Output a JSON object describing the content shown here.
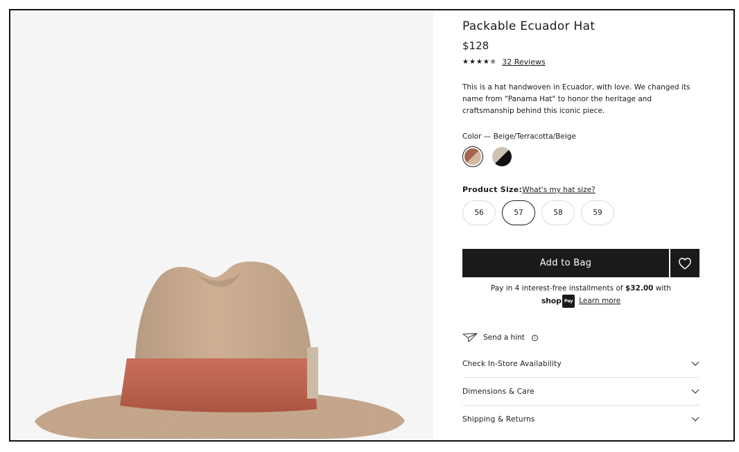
{
  "product": {
    "title": "Packable Ecuador Hat",
    "price": "$128",
    "stars": "★★★★✯",
    "reviews_link": "32 Reviews",
    "description": "This is a hat handwoven in Ecuador, with love. We changed its name from \"Panama Hat\" to honor the heritage and craftsmanship behind this iconic piece."
  },
  "color": {
    "label": "Color — Beige/Terracotta/Beige",
    "swatches": [
      {
        "name": "Beige/Terracotta/Beige",
        "colors": [
          "#a5654a",
          "#d2b8a1"
        ],
        "selected": true
      },
      {
        "name": "Black/Beige",
        "colors": [
          "#111111",
          "#cfc2b4"
        ],
        "selected": false
      }
    ]
  },
  "size": {
    "label": "Product Size:",
    "help_link": "What's my hat size?",
    "options": [
      "56",
      "57",
      "58",
      "59"
    ],
    "selected": "57"
  },
  "cart": {
    "add_label": "Add to Bag"
  },
  "installments": {
    "text_before": "Pay in 4 interest-free installments of ",
    "amount": "$32.00",
    "text_after": " with",
    "shop_logo": "shop",
    "pay_badge": "Pay",
    "learn_more": "Learn more"
  },
  "hint": {
    "label": "Send a hint",
    "info_glyph": "i"
  },
  "accordion": [
    {
      "label": "Check In-Store Availability"
    },
    {
      "label": "Dimensions & Care"
    },
    {
      "label": "Shipping & Returns"
    }
  ],
  "icons": {
    "heart": "heart-icon",
    "paper_plane": "paper-plane-icon",
    "chevron": "chevron-down-icon"
  },
  "colors": {
    "accent": "#1a1a1a",
    "gallery_bg": "#f5f5f5",
    "hat_straw": "#d4b59a",
    "hat_band": "#c2604a"
  }
}
